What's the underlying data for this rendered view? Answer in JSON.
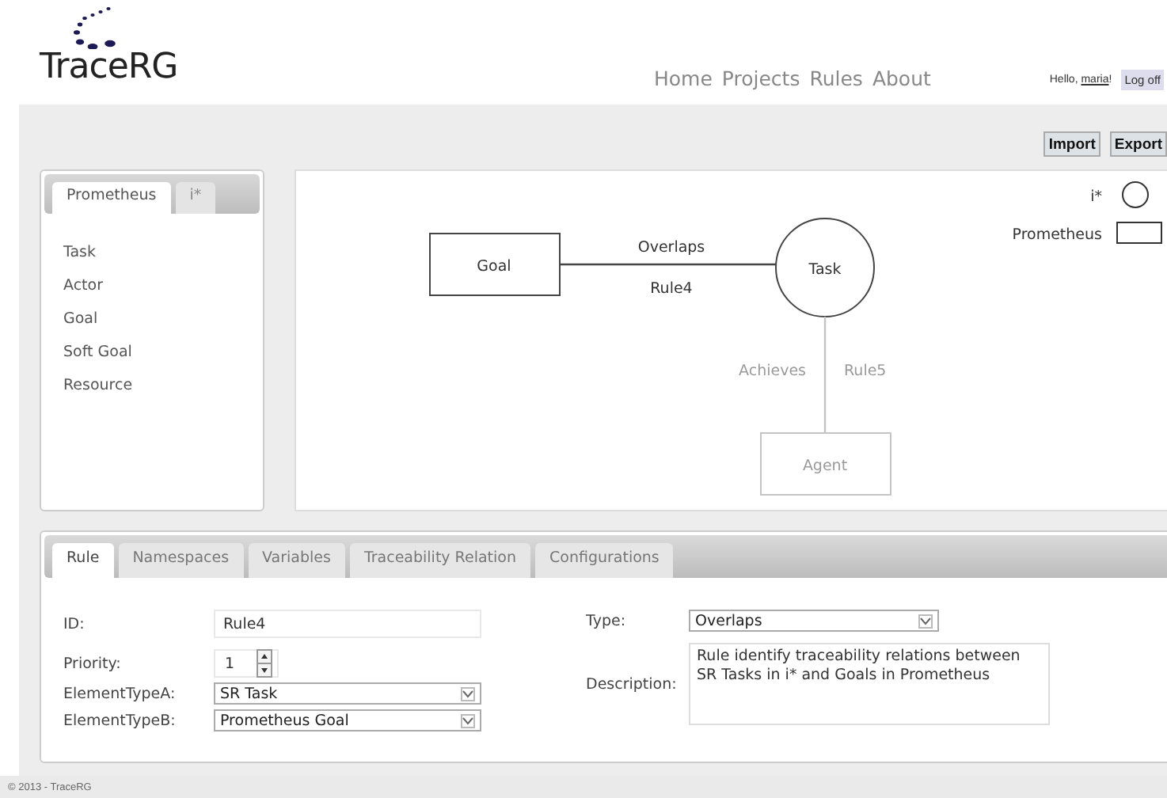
{
  "header": {
    "logo": "TraceRG",
    "nav": [
      {
        "label": "Home"
      },
      {
        "label": "Projects"
      },
      {
        "label": "Rules"
      },
      {
        "label": "About"
      }
    ],
    "greeting": "Hello, ",
    "user": "maria",
    "greeting_end": "!",
    "logoff": "Log off"
  },
  "toolbar": {
    "buttons": [
      "Import",
      "Export"
    ]
  },
  "palette": {
    "tabs": [
      {
        "label": "Prometheus",
        "selected": true
      },
      {
        "label": "i*",
        "selected": false
      }
    ],
    "items": [
      "Task",
      "Actor",
      "Goal",
      "Soft Goal",
      "Resource"
    ]
  },
  "diagram": {
    "nodes": [
      {
        "label": "Goal",
        "kind": "rect",
        "dimmed": false
      },
      {
        "label": "Task",
        "kind": "circle",
        "dimmed": false
      },
      {
        "label": "Agent",
        "kind": "rect",
        "dimmed": true
      }
    ],
    "edges": [
      {
        "label": "Overlaps",
        "rule": "Rule4",
        "dimmed": false
      },
      {
        "label": "Achieves",
        "rule": "Rule5",
        "dimmed": true
      }
    ],
    "legend": [
      {
        "label": "i*",
        "kind": "circle"
      },
      {
        "label": "Prometheus",
        "kind": "rect"
      }
    ]
  },
  "editor": {
    "tabs": [
      {
        "label": "Rule",
        "selected": true
      },
      {
        "label": "Namespaces",
        "selected": false
      },
      {
        "label": "Variables",
        "selected": false
      },
      {
        "label": "Traceability Relation",
        "selected": false
      },
      {
        "label": "Configurations",
        "selected": false
      }
    ],
    "id": {
      "label": "ID:",
      "value": "Rule4"
    },
    "priority": {
      "label": "Priority:",
      "value": "1"
    },
    "element_type_a": {
      "label": "ElementTypeA:",
      "value": "SR Task"
    },
    "element_type_b": {
      "label": "ElementTypeB:",
      "value": "Prometheus Goal"
    },
    "type": {
      "label": "Type:",
      "value": "Overlaps"
    },
    "description": {
      "label": "Description:",
      "value": "Rule identify traceability relations between SR Tasks in i* and Goals in Prometheus"
    }
  },
  "footer": "© 2013 - TraceRG"
}
